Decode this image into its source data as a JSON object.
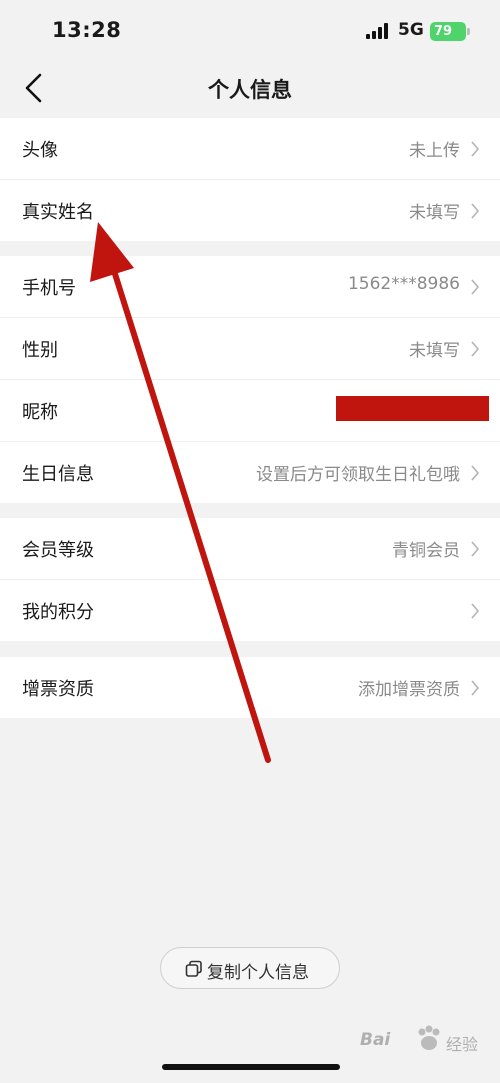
{
  "status_bar": {
    "time": "13:28",
    "network": "5G",
    "battery": "79"
  },
  "header": {
    "title": "个人信息",
    "back_icon": "chevron-left-icon"
  },
  "groups": [
    {
      "rows": [
        {
          "label": "头像",
          "value": "未上传"
        },
        {
          "label": "真实姓名",
          "value": "未填写"
        }
      ]
    },
    {
      "rows": [
        {
          "label": "手机号",
          "value": "1562***8986"
        },
        {
          "label": "性别",
          "value": "未填写"
        },
        {
          "label": "昵称",
          "value": ""
        },
        {
          "label": "生日信息",
          "value": "设置后方可领取生日礼包哦"
        }
      ]
    },
    {
      "rows": [
        {
          "label": "会员等级",
          "value": "青铜会员"
        },
        {
          "label": "我的积分",
          "value": ""
        }
      ]
    },
    {
      "rows": [
        {
          "label": "增票资质",
          "value": "添加增票资质"
        }
      ]
    }
  ],
  "footer": {
    "copy_label": "复制个人信息",
    "copy_icon": "copy-icon"
  },
  "watermark": {
    "text": "Bai",
    "text2": "经验"
  },
  "colors": {
    "annotation_arrow": "#c0150f",
    "redaction": "#c0150f",
    "battery": "#4fd36b"
  }
}
